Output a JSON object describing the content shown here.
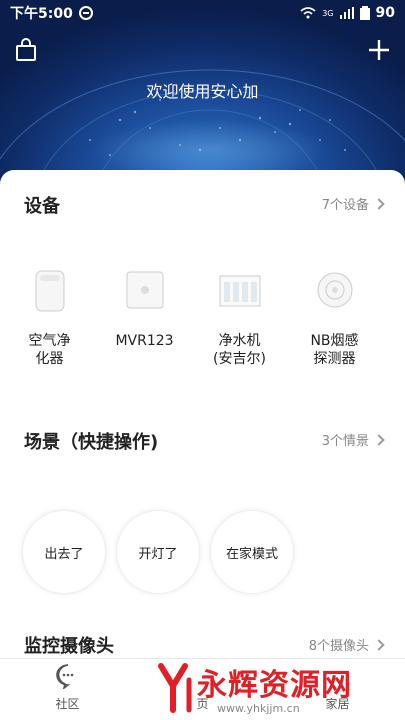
{
  "status_bar": {
    "time": "下午5:00",
    "network": "3G",
    "battery": "90"
  },
  "header": {
    "welcome": "欢迎使用安心加"
  },
  "devices": {
    "title": "设备",
    "link": "7个设备",
    "items": [
      {
        "label": "空气净\n化器",
        "icon": "air-purifier-icon"
      },
      {
        "label": "MVR123",
        "icon": "mvr-device-icon"
      },
      {
        "label": "净水机\n(安吉尔)",
        "icon": "water-purifier-icon"
      },
      {
        "label": "NB烟感\n探测器",
        "icon": "smoke-detector-icon"
      }
    ]
  },
  "scenes": {
    "title": "场景（快捷操作)",
    "link": "3个情景",
    "items": [
      {
        "label": "出去了"
      },
      {
        "label": "开灯了"
      },
      {
        "label": "在家模式"
      }
    ]
  },
  "cameras": {
    "title": "监控摄像头",
    "link": "8个摄像头"
  },
  "bottom_nav": {
    "items": [
      {
        "label": "社区",
        "icon": "chat-icon"
      },
      {
        "label": "页",
        "icon": "home-icon"
      },
      {
        "label": "家居",
        "icon": "house-icon"
      }
    ]
  },
  "watermark": {
    "text": "永辉资源网",
    "url": "www.yhkjjm.cn"
  },
  "colors": {
    "hero_dark": "#0a1d4b",
    "hero_light": "#2f74c9",
    "accent_red": "#e21f26"
  }
}
